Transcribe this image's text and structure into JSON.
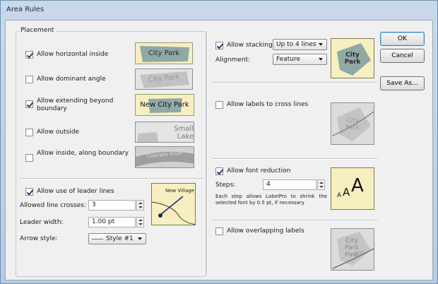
{
  "window": {
    "title": "Area Rules"
  },
  "placement": {
    "legend": "Placement",
    "options": [
      {
        "label": "Allow horizontal inside",
        "checked": true,
        "preview_text": "City Park"
      },
      {
        "label": "Allow dominant angle",
        "checked": false,
        "preview_text": "City Park"
      },
      {
        "label": "Allow extending beyond boundary",
        "checked": true,
        "preview_text": "New City Park"
      },
      {
        "label": "Allow outside",
        "checked": false,
        "preview_text": "Small Lake"
      },
      {
        "label": "Allow inside, along boundary",
        "checked": false,
        "preview_text": "Colorado River"
      }
    ]
  },
  "leader": {
    "label": "Allow use of leader lines",
    "checked": true,
    "line_crosses_label": "Allowed line crosses:",
    "line_crosses_value": "3",
    "width_label": "Leader width:",
    "width_value": "1.00 pt",
    "arrow_label": "Arrow style:",
    "arrow_value": "Style #1",
    "preview_text": "New Village"
  },
  "stacking": {
    "label": "Allow stacking",
    "checked": true,
    "lines_value": "Up to 4 lines",
    "alignment_label": "Alignment:",
    "alignment_value": "Feature",
    "preview_line1": "City",
    "preview_line2": "Park"
  },
  "cross_lines": {
    "label": "Allow labels to cross lines",
    "checked": false,
    "preview_line1": "City",
    "preview_line2": "Park"
  },
  "font_reduction": {
    "label": "Allow font reduction",
    "checked": true,
    "steps_label": "Steps:",
    "steps_value": "4",
    "description": "Each step allows LabelPro to shrink the selected font by 0.5 pt, if necessary",
    "preview_small": "A",
    "preview_medium": "A",
    "preview_large": "A"
  },
  "overlapping": {
    "label": "Allow overlapping labels",
    "checked": false,
    "preview_line1": "City",
    "preview_line2": "Park",
    "preview_line3": "Park",
    "preview_overlap": "Way"
  },
  "buttons": {
    "ok": "OK",
    "cancel": "Cancel",
    "save_as": "Save As..."
  },
  "colors": {
    "preview_bg_yellow": "#f7efc0",
    "preview_bg_gray": "#d9d9d9",
    "area_fill": "#8fa9a5",
    "area_fill_gray": "#bcbcbc"
  }
}
